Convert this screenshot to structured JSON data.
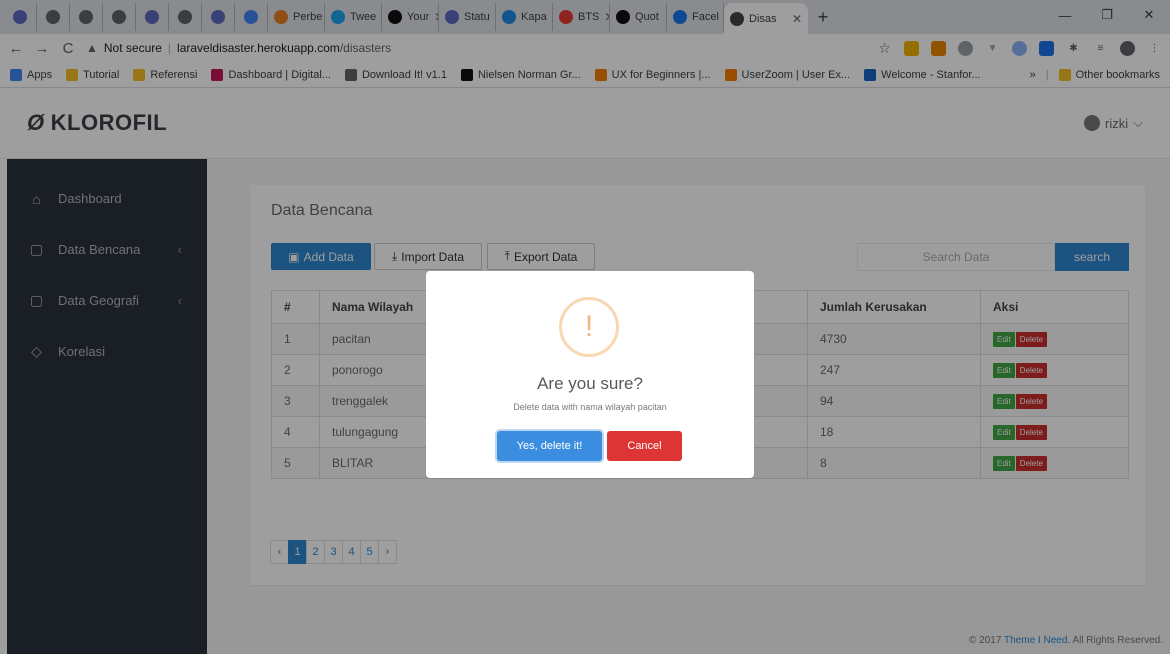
{
  "browser": {
    "tabs": [
      {
        "label": "",
        "pinned": true,
        "color": "#5c6bc0"
      },
      {
        "label": "",
        "pinned": true,
        "color": "#5f6368"
      },
      {
        "label": "",
        "pinned": true,
        "color": "#5f6368"
      },
      {
        "label": "",
        "pinned": true,
        "color": "#5f6368"
      },
      {
        "label": "",
        "pinned": true,
        "color": "#5c6bc0"
      },
      {
        "label": "",
        "pinned": true,
        "color": "#5f6368"
      },
      {
        "label": "",
        "pinned": true,
        "color": "#5c6bc0"
      },
      {
        "label": "",
        "pinned": true,
        "color": "#4285f4"
      },
      {
        "label": "Perbe",
        "pinned": false,
        "color": "#e67e22"
      },
      {
        "label": "Twee",
        "pinned": false,
        "color": "#1da1f2"
      },
      {
        "label": "Your",
        "pinned": false,
        "color": "#111111"
      },
      {
        "label": "Statu",
        "pinned": false,
        "color": "#5c6bc0"
      },
      {
        "label": "Kapa",
        "pinned": false,
        "color": "#1e88e5"
      },
      {
        "label": "BTS",
        "pinned": false,
        "color": "#e53935"
      },
      {
        "label": "Quot",
        "pinned": false,
        "color": "#111111"
      },
      {
        "label": "Facel",
        "pinned": false,
        "color": "#1877f2"
      },
      {
        "label": "Disas",
        "pinned": false,
        "color": "#444444",
        "active": true
      }
    ],
    "new_tab": "+",
    "window_controls": [
      "—",
      "❐",
      "✕"
    ],
    "security_label": "Not secure",
    "url_host": "laraveldisaster.herokuapp.com",
    "url_path": "/disasters",
    "bookmarks": [
      {
        "label": "Apps",
        "color": "#4285f4"
      },
      {
        "label": "Tutorial",
        "color": "#f6bf26"
      },
      {
        "label": "Referensi",
        "color": "#f6bf26"
      },
      {
        "label": "Dashboard | Digital...",
        "color": "#c2185b"
      },
      {
        "label": "Download It! v1.1",
        "color": "#5f6368"
      },
      {
        "label": "Nielsen Norman Gr...",
        "color": "#111111"
      },
      {
        "label": "UX for Beginners |...",
        "color": "#f57c00"
      },
      {
        "label": "UserZoom | User Ex...",
        "color": "#f57c00"
      },
      {
        "label": "Welcome - Stanfor...",
        "color": "#1565c0"
      }
    ],
    "bookmarks_more": "»",
    "other_bookmarks": "Other bookmarks"
  },
  "header": {
    "brand": "KLOROFIL",
    "user": "rizki"
  },
  "sidebar": {
    "items": [
      {
        "label": "Dashboard",
        "icon": "home-icon",
        "has_submenu": false
      },
      {
        "label": "Data Bencana",
        "icon": "file-icon",
        "has_submenu": true
      },
      {
        "label": "Data Geografi",
        "icon": "file-icon",
        "has_submenu": true
      },
      {
        "label": "Korelasi",
        "icon": "chart-icon",
        "has_submenu": false
      }
    ]
  },
  "main": {
    "title": "Data Bencana",
    "add_label": "Add Data",
    "import_label": "Import Data",
    "export_label": "Export Data",
    "search_placeholder": "Search Data",
    "search_label": "search",
    "table": {
      "columns": [
        "#",
        "Nama Wilayah",
        "",
        "",
        "Jumlah Kerusakan",
        "Aksi"
      ],
      "rows": [
        [
          "1",
          "pacitan",
          "",
          "",
          "4730"
        ],
        [
          "2",
          "ponorogo",
          "",
          "",
          "247"
        ],
        [
          "3",
          "trenggalek",
          "",
          "",
          "94"
        ],
        [
          "4",
          "tulungagung",
          "",
          "",
          "18"
        ],
        [
          "5",
          "BLITAR",
          "",
          "",
          "8"
        ]
      ],
      "edit_label": "Edit",
      "delete_label": "Delete"
    },
    "pagination": {
      "prev": "‹",
      "pages": [
        "1",
        "2",
        "3",
        "4",
        "5"
      ],
      "current": "1",
      "next": "›"
    }
  },
  "footer": {
    "prefix": "© 2017",
    "link": "Theme I Need",
    "suffix": ". All Rights Reserved."
  },
  "modal": {
    "icon": "!",
    "title": "Are you sure?",
    "text": "Delete data with nama wilayah pacitan",
    "confirm_label": "Yes, delete it!",
    "cancel_label": "Cancel"
  }
}
